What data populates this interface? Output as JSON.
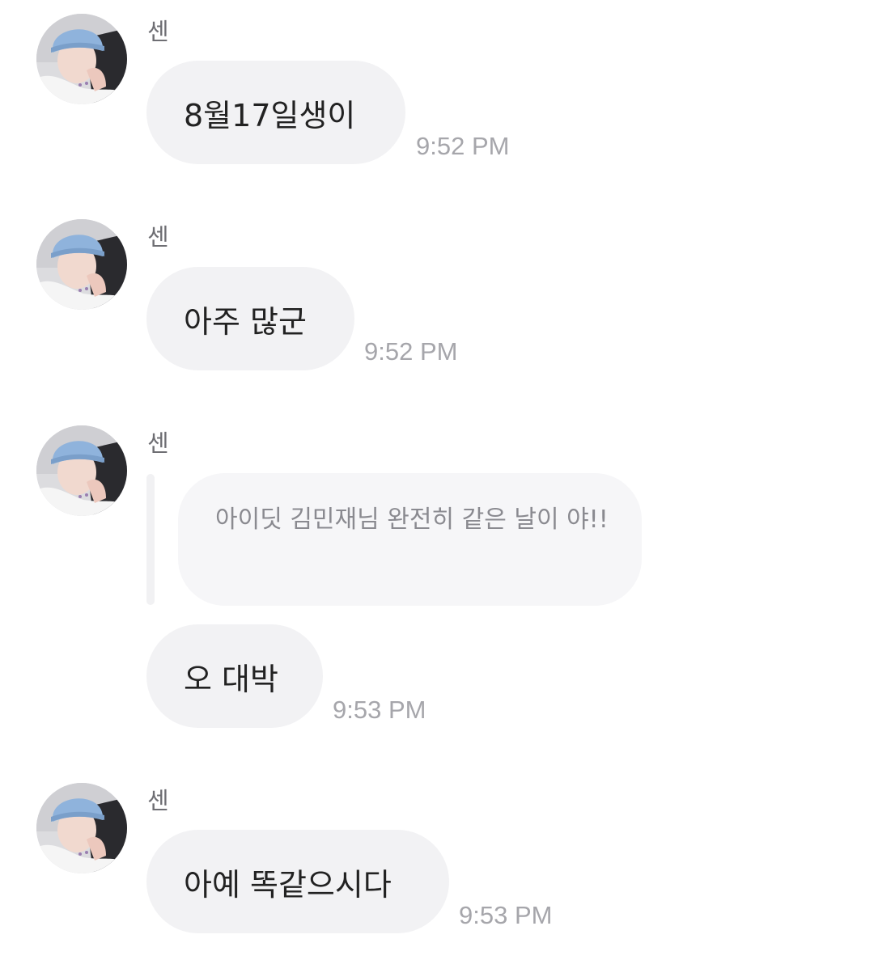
{
  "messages": [
    {
      "sender": "센",
      "text": "8월17일생이",
      "time": "9:52 PM"
    },
    {
      "sender": "센",
      "text": "아주 많군",
      "time": "9:52 PM"
    },
    {
      "sender": "센",
      "quote": "아이딧 김민재님 완전히 같은 날이 야!!",
      "text": "오 대박",
      "time": "9:53 PM"
    },
    {
      "sender": "센",
      "text": "아예 똑같으시다",
      "time": "9:53 PM"
    }
  ],
  "colors": {
    "bubble": "#f2f2f4",
    "quote_bubble": "#f6f6f8",
    "timestamp": "#a6a6ab",
    "sender": "#6e6e73",
    "avatar_beanie": "#8fb3dc"
  },
  "icons": {
    "avatar": "profile-photo-avatar"
  }
}
